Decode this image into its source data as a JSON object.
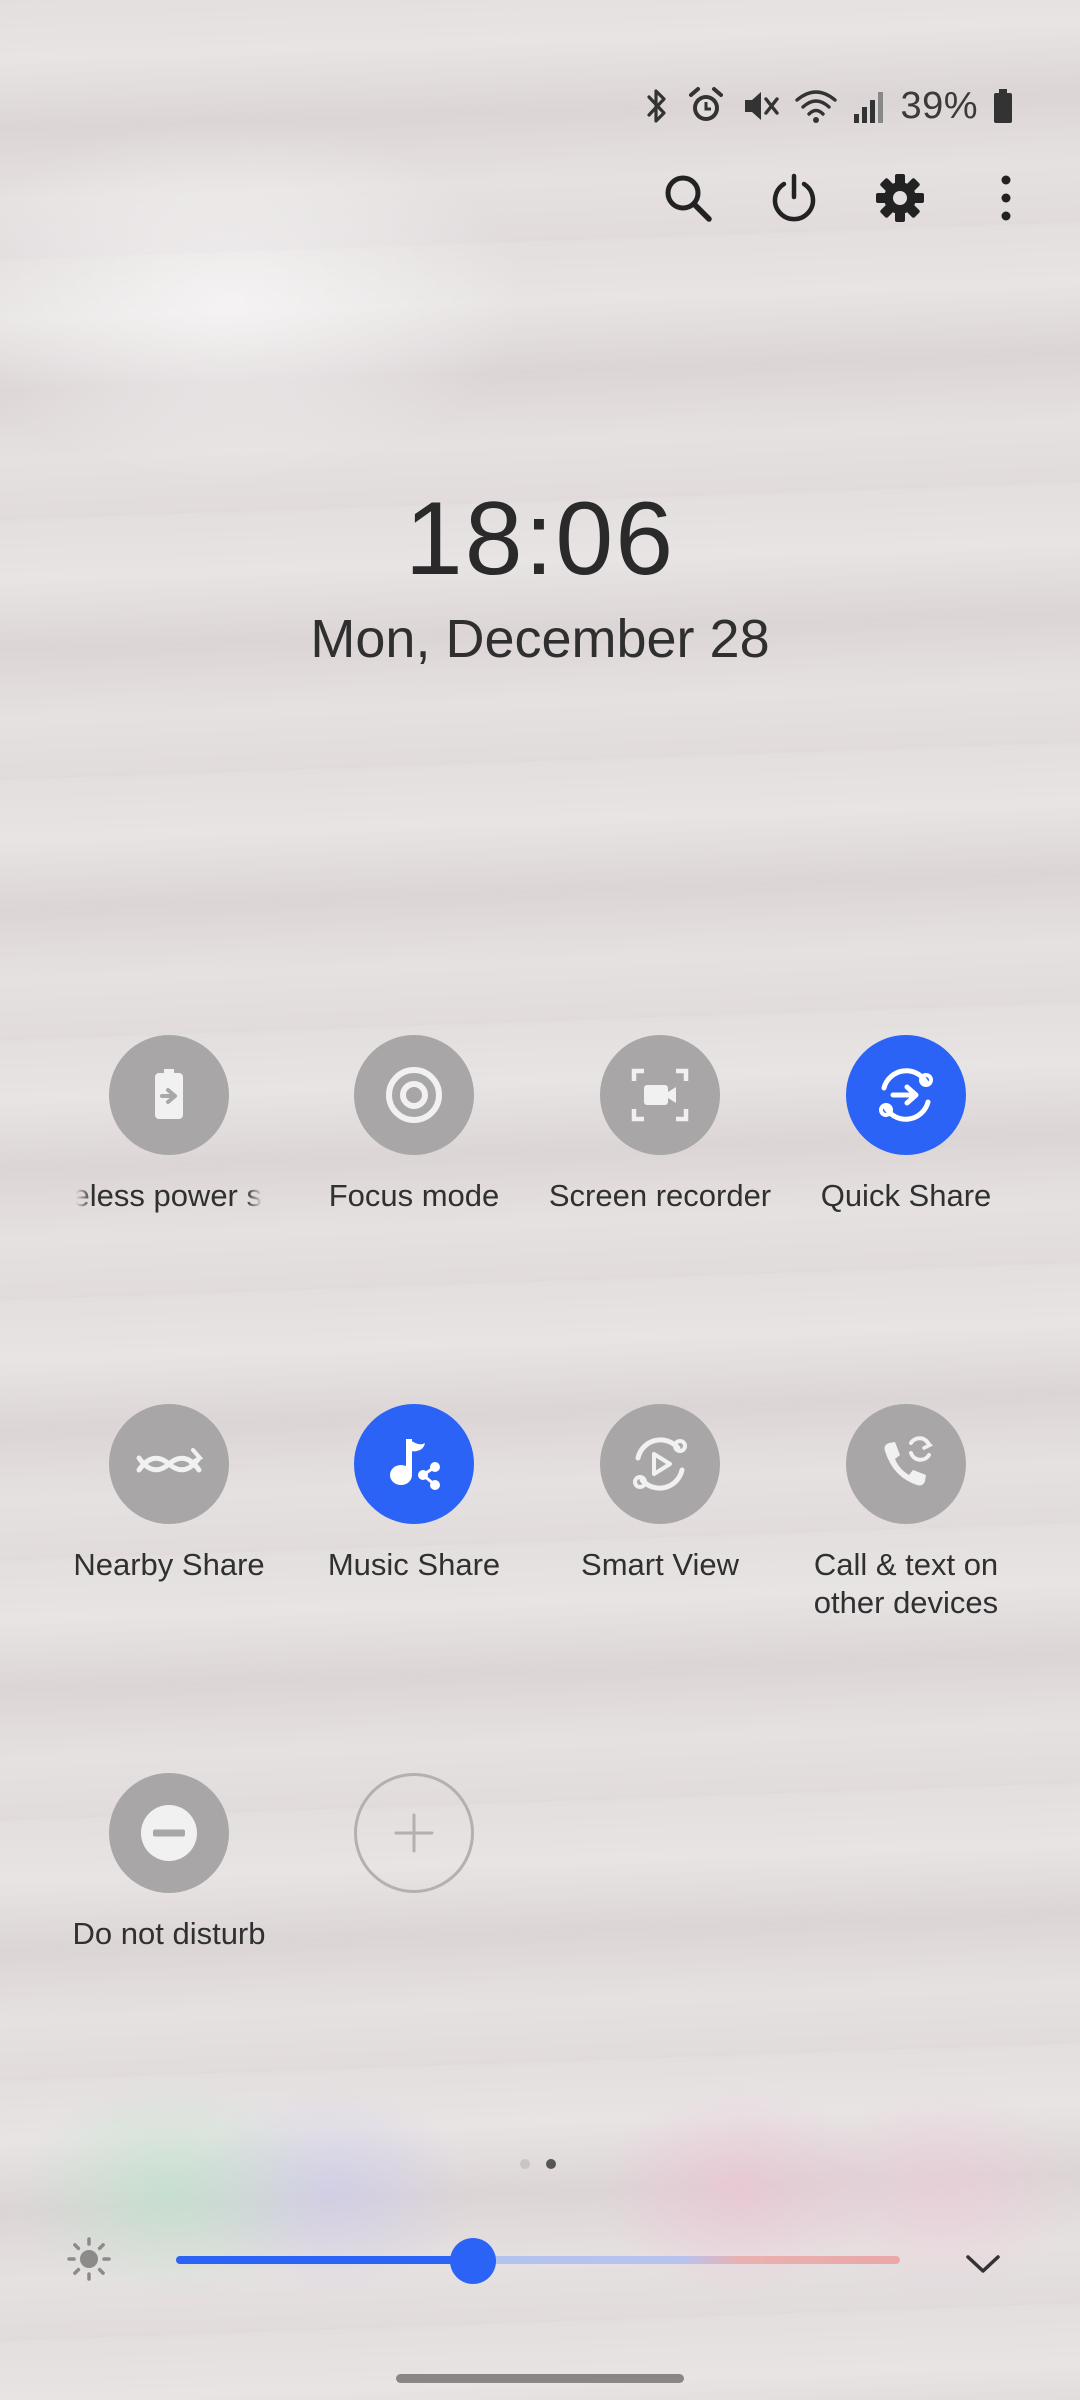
{
  "status_bar": {
    "icons": [
      "bluetooth-icon",
      "alarm-icon",
      "vibrate-mute-icon",
      "wifi-icon",
      "signal-icon",
      "battery-icon"
    ],
    "battery_percent": "39%"
  },
  "top_actions": [
    "search-icon",
    "power-icon",
    "settings-icon",
    "more-options-icon"
  ],
  "clock": {
    "time": "18:06",
    "date": "Mon, December 28"
  },
  "tiles": [
    {
      "label": "eless power s",
      "icon": "wireless-power-share-icon",
      "active": false
    },
    {
      "label": "Focus mode",
      "icon": "focus-mode-icon",
      "active": false
    },
    {
      "label": "Screen recorder",
      "icon": "screen-recorder-icon",
      "active": false
    },
    {
      "label": "Quick Share",
      "icon": "quick-share-icon",
      "active": true
    },
    {
      "label": "Nearby Share",
      "icon": "nearby-share-icon",
      "active": false
    },
    {
      "label": "Music Share",
      "icon": "music-share-icon",
      "active": true
    },
    {
      "label": "Smart View",
      "icon": "smart-view-icon",
      "active": false
    },
    {
      "label": "Call & text on other devices",
      "icon": "call-text-other-devices-icon",
      "active": false
    },
    {
      "label": "Do not disturb",
      "icon": "do-not-disturb-icon",
      "active": false
    },
    {
      "label": "",
      "icon": "add-icon",
      "active": false
    }
  ],
  "pager": {
    "pages": 2,
    "current": 2
  },
  "brightness": {
    "level": 0.41
  },
  "colors": {
    "accent": "#2c63f7",
    "tile_inactive": "#a8a6a6"
  }
}
